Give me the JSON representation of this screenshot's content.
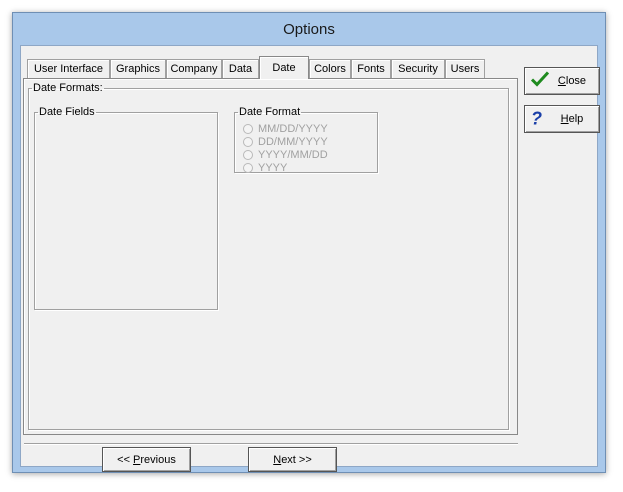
{
  "window": {
    "title": "Options"
  },
  "tabs": [
    {
      "label": "User Interface",
      "active": false
    },
    {
      "label": "Graphics",
      "active": false
    },
    {
      "label": "Company",
      "active": false
    },
    {
      "label": "Data",
      "active": false
    },
    {
      "label": "Date",
      "active": true
    },
    {
      "label": "Colors",
      "active": false
    },
    {
      "label": "Fonts",
      "active": false
    },
    {
      "label": "Security",
      "active": false
    },
    {
      "label": "Users",
      "active": false
    }
  ],
  "date_formats": {
    "group_label": "Date Formats:",
    "date_fields_label": "Date Fields",
    "date_format_label": "Date Format",
    "options": [
      "MM/DD/YYYY",
      "DD/MM/YYYY",
      "YYYY/MM/DD",
      "YYYY"
    ]
  },
  "side_buttons": {
    "close_prefix": "",
    "close_mnemonic": "C",
    "close_rest": "lose",
    "help_mnemonic": "H",
    "help_rest": "elp",
    "close_icon_color": "#1e8a1e",
    "help_icon_color": "#1a3fa8"
  },
  "nav_buttons": {
    "prev_prefix": "<< ",
    "prev_mnemonic": "P",
    "prev_rest": "revious",
    "next_mnemonic": "N",
    "next_rest": "ext >>"
  }
}
